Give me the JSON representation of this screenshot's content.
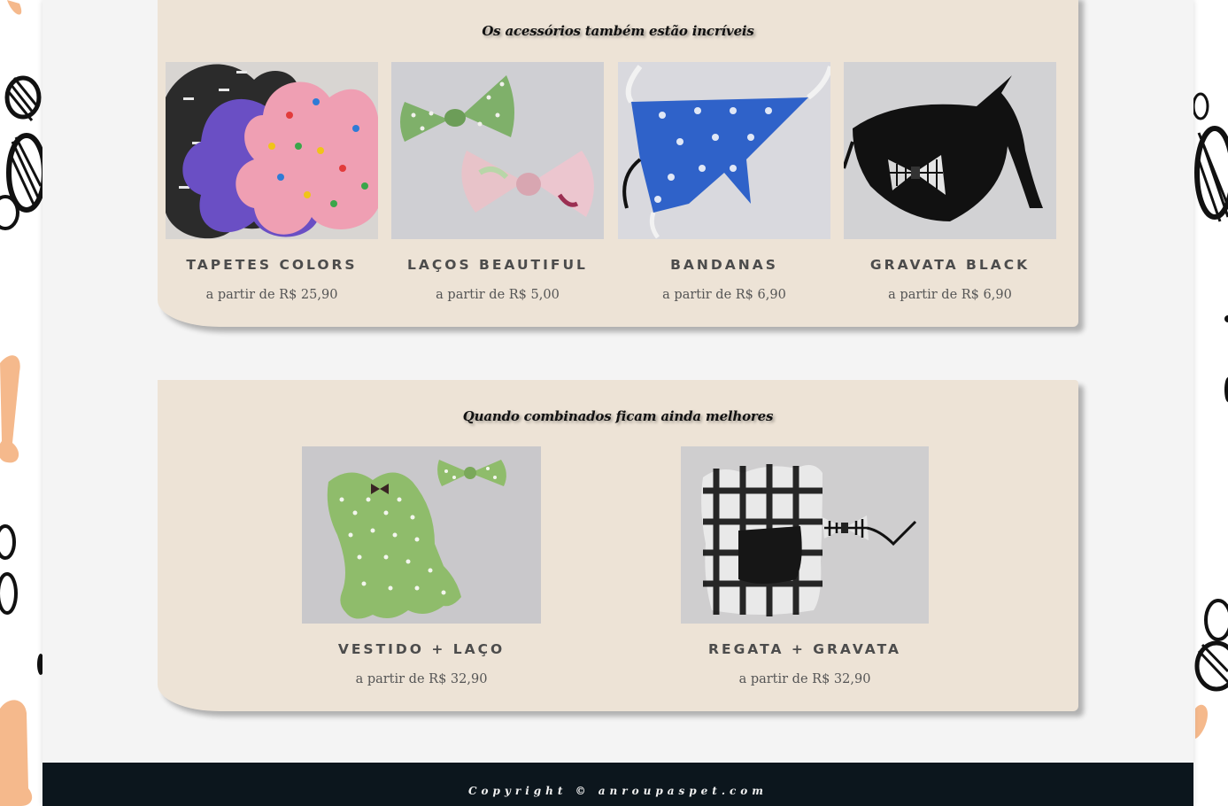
{
  "accessories": {
    "title": "Os acessórios também estão incríveis",
    "items": [
      {
        "name": "TAPETES COLORS",
        "price": "a partir de R$ 25,90",
        "image": "colorful-paw-shaped-mats-photo"
      },
      {
        "name": "LAÇOS BEAUTIFUL",
        "price": "a partir de R$ 5,00",
        "image": "dog-hair-bows-photo"
      },
      {
        "name": "BANDANAS",
        "price": "a partir de R$ 6,90",
        "image": "blue-bandana-photo"
      },
      {
        "name": "GRAVATA BLACK",
        "price": "a partir de R$ 6,90",
        "image": "black-tie-collar-photo"
      }
    ]
  },
  "combos": {
    "title": "Quando combinados ficam ainda melhores",
    "items": [
      {
        "name": "VESTIDO + LAÇO",
        "price": "a partir de R$ 32,90",
        "image": "green-polka-dot-dress-with-bow-photo"
      },
      {
        "name": "REGATA + GRAVATA",
        "price": "a partir de R$ 32,90",
        "image": "plaid-shirt-with-bow-tie-photo"
      }
    ]
  },
  "footer": {
    "copyright": "Copyright © anroupaspet.com"
  },
  "colors": {
    "panel": "#ede3d6",
    "page": "#f4f4f4",
    "footer": "#0c161d",
    "text": "#4c4c4c"
  }
}
